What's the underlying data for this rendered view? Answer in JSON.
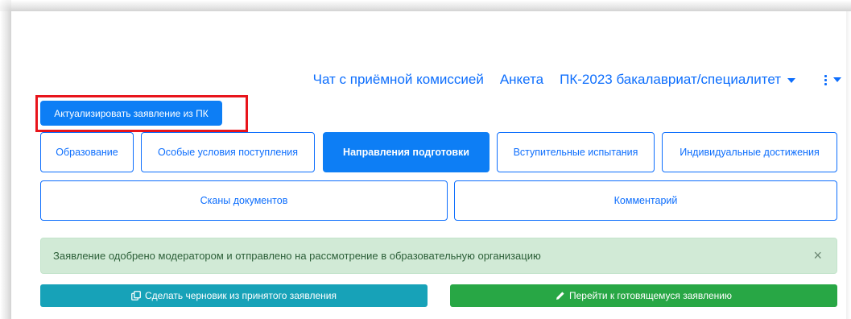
{
  "nav": {
    "chat": "Чат с приёмной комиссией",
    "profile": "Анкета",
    "campaign": "ПК-2023 бакалавриат/специалитет"
  },
  "actions": {
    "refresh_label": "Актуализировать заявление из ПК"
  },
  "tabs": [
    {
      "label": "Образование",
      "active": false
    },
    {
      "label": "Особые условия поступления",
      "active": false
    },
    {
      "label": "Направления подготовки",
      "active": true
    },
    {
      "label": "Вступительные испытания",
      "active": false
    },
    {
      "label": "Индивидуальные достижения",
      "active": false
    },
    {
      "label": "Сканы документов",
      "active": false
    },
    {
      "label": "Комментарий",
      "active": false
    }
  ],
  "alert": {
    "text": "Заявление одобрено модератором и отправлено на рассмотрение в образовательную организацию",
    "close": "×"
  },
  "buttons": {
    "draft": "Сделать черновик из принятого заявления",
    "goto": "Перейти к готовящемуся заявлению"
  },
  "colors": {
    "primary": "#0d7ef5",
    "info": "#17a2b8",
    "success": "#28a745",
    "alert_bg": "#d1ead6",
    "highlight": "#e8141b"
  }
}
